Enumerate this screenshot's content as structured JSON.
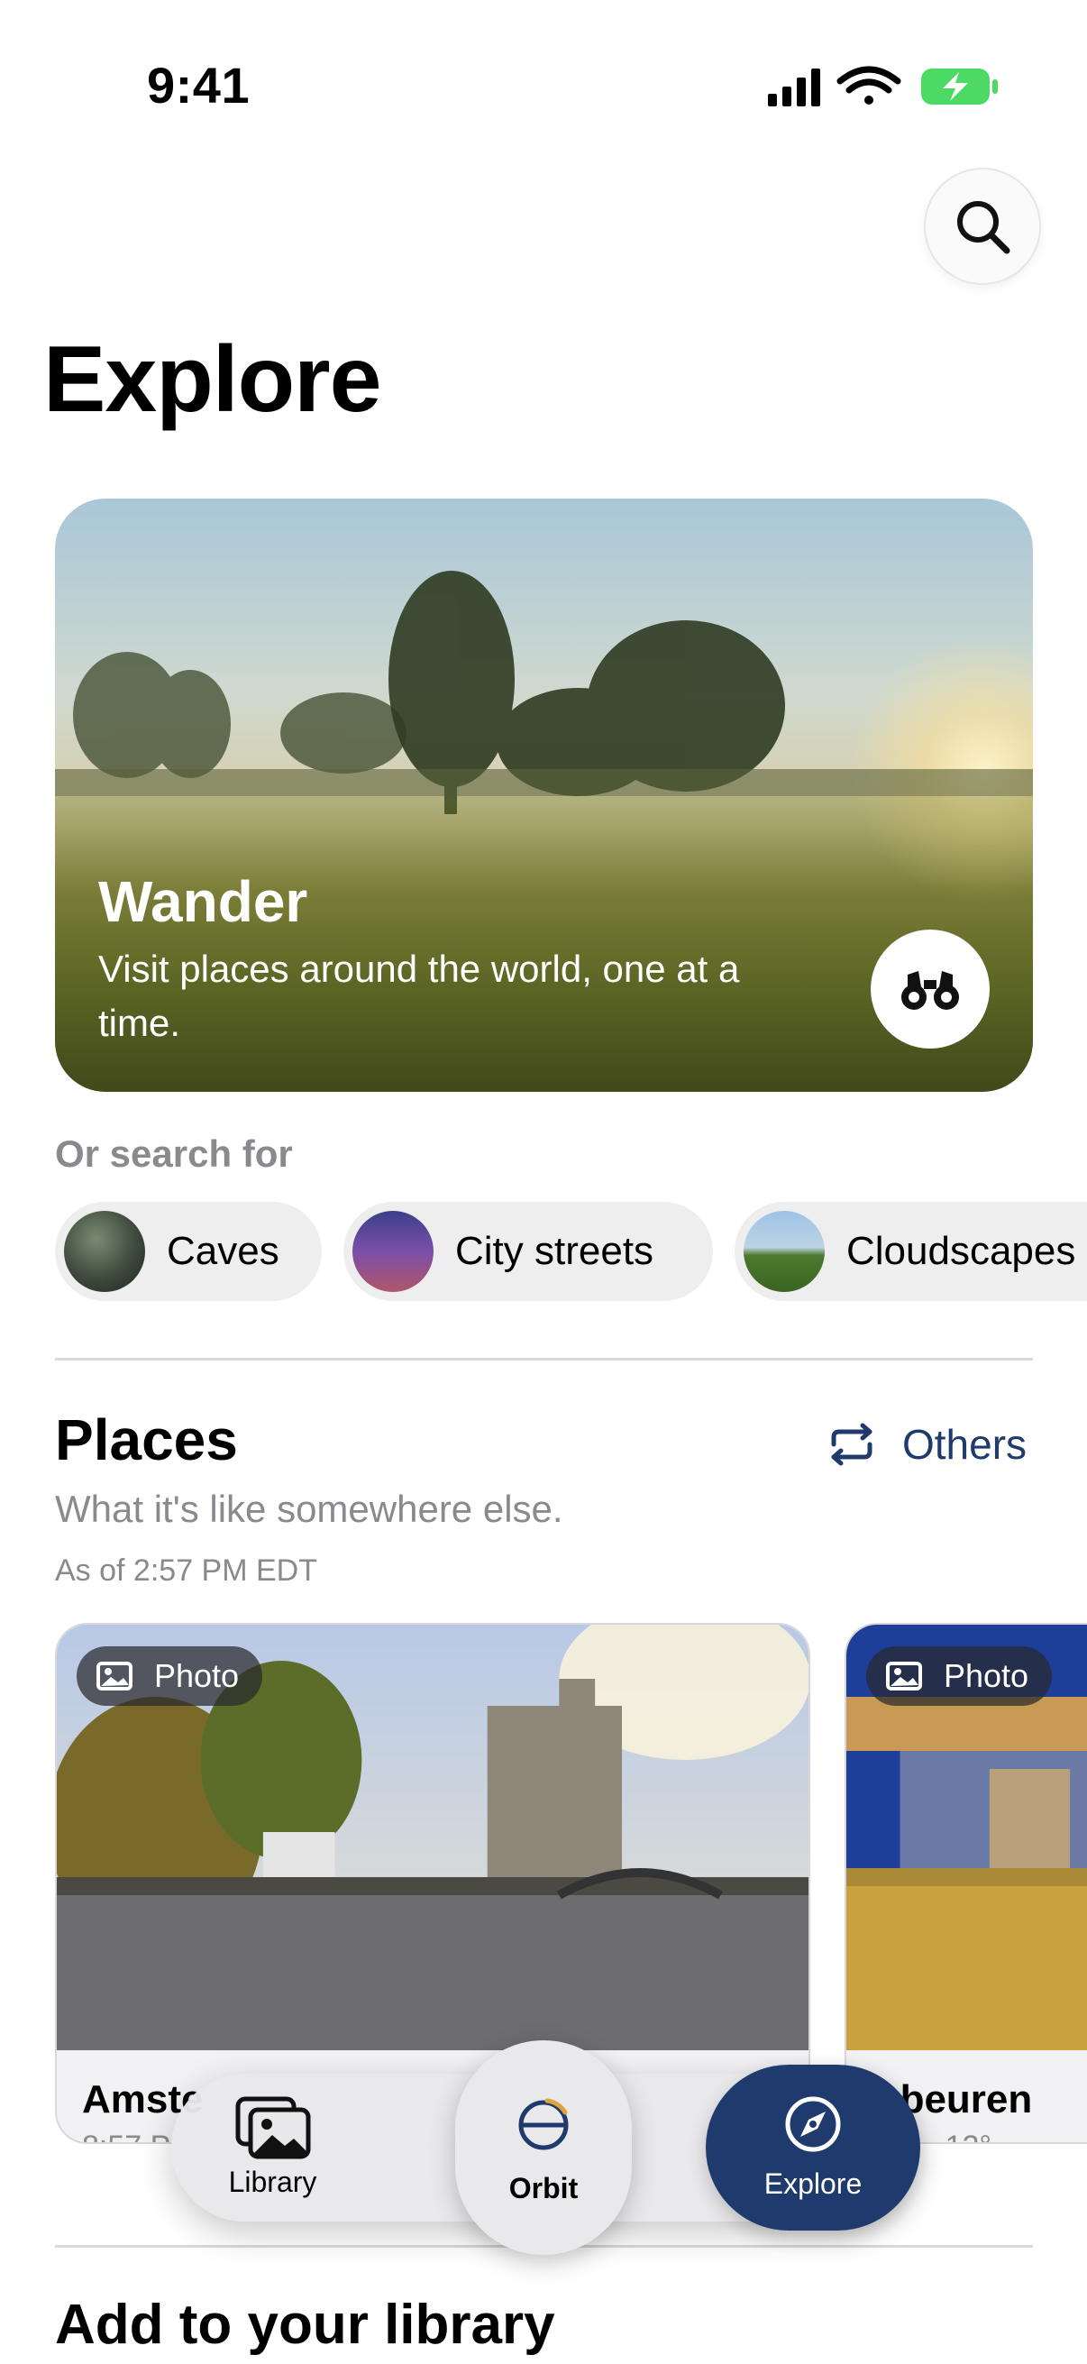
{
  "status_bar": {
    "time": "9:41"
  },
  "header": {
    "title": "Explore"
  },
  "hero": {
    "title": "Wander",
    "subtitle": "Visit places around the world, one at a time."
  },
  "search_suggestions": {
    "label": "Or search for",
    "chips": [
      {
        "label": "Caves"
      },
      {
        "label": "City streets"
      },
      {
        "label": "Cloudscapes"
      }
    ]
  },
  "places": {
    "title": "Places",
    "others_label": "Others",
    "subtitle": "What it's like somewhere else.",
    "as_of": "As of 2:57 PM EDT",
    "cards": [
      {
        "badge": "Photo",
        "title": "Amste",
        "meta": "8:57 P"
      },
      {
        "badge": "Photo",
        "title": "laubeuren",
        "meta": "7 PM · 12°"
      }
    ]
  },
  "tab_bar": {
    "tabs": [
      {
        "label": "Library",
        "icon": "photos-icon"
      },
      {
        "label": "Orbit",
        "icon": "orbit-icon"
      },
      {
        "label": "Explore",
        "icon": "compass-icon",
        "selected": true
      }
    ]
  },
  "add_section": {
    "title": "Add to your library"
  },
  "colors": {
    "accent": "#1f3a6d",
    "battery": "#4cd964"
  }
}
